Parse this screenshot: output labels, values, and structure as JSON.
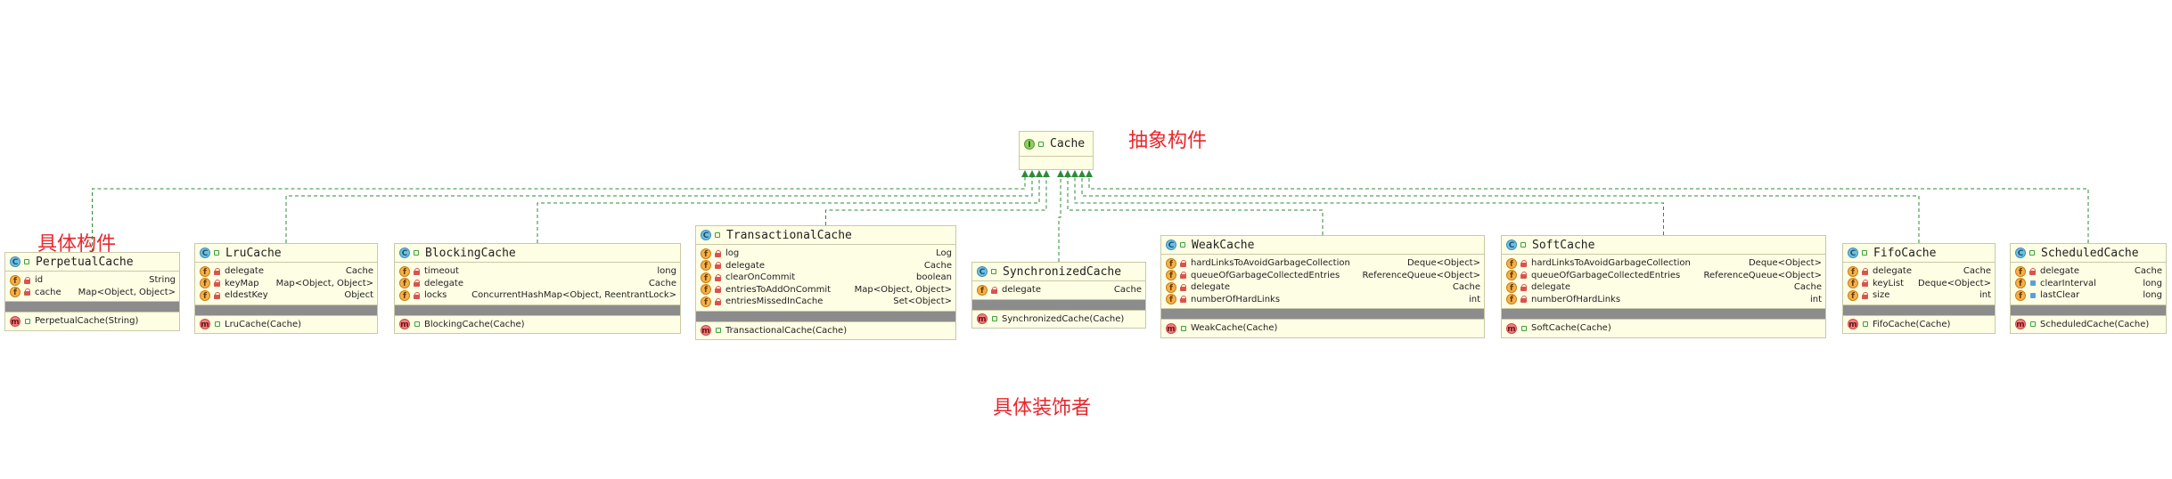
{
  "diagram": {
    "interface": {
      "name": "Cache",
      "icon": "interface-icon"
    },
    "labels": {
      "abstract_component": "抽象构件",
      "concrete_component": "具体构件",
      "concrete_decorator": "具体装饰者"
    },
    "classes": [
      {
        "key": "perpetual",
        "name": "PerpetualCache",
        "fields": [
          {
            "name": "id",
            "type": "String"
          },
          {
            "name": "cache",
            "type": "Map<Object, Object>"
          }
        ],
        "methods": [
          "PerpetualCache(String)"
        ]
      },
      {
        "key": "lru",
        "name": "LruCache",
        "fields": [
          {
            "name": "delegate",
            "type": "Cache"
          },
          {
            "name": "keyMap",
            "type": "Map<Object, Object>"
          },
          {
            "name": "eldestKey",
            "type": "Object"
          }
        ],
        "methods": [
          "LruCache(Cache)"
        ]
      },
      {
        "key": "blocking",
        "name": "BlockingCache",
        "fields": [
          {
            "name": "timeout",
            "type": "long"
          },
          {
            "name": "delegate",
            "type": "Cache"
          },
          {
            "name": "locks",
            "type": "ConcurrentHashMap<Object, ReentrantLock>"
          }
        ],
        "methods": [
          "BlockingCache(Cache)"
        ]
      },
      {
        "key": "transactional",
        "name": "TransactionalCache",
        "fields": [
          {
            "name": "log",
            "type": "Log"
          },
          {
            "name": "delegate",
            "type": "Cache"
          },
          {
            "name": "clearOnCommit",
            "type": "boolean"
          },
          {
            "name": "entriesToAddOnCommit",
            "type": "Map<Object, Object>"
          },
          {
            "name": "entriesMissedInCache",
            "type": "Set<Object>"
          }
        ],
        "methods": [
          "TransactionalCache(Cache)"
        ]
      },
      {
        "key": "synchronized",
        "name": "SynchronizedCache",
        "fields": [
          {
            "name": "delegate",
            "type": "Cache"
          }
        ],
        "methods": [
          "SynchronizedCache(Cache)"
        ]
      },
      {
        "key": "weak",
        "name": "WeakCache",
        "fields": [
          {
            "name": "hardLinksToAvoidGarbageCollection",
            "type": "Deque<Object>"
          },
          {
            "name": "queueOfGarbageCollectedEntries",
            "type": "ReferenceQueue<Object>"
          },
          {
            "name": "delegate",
            "type": "Cache"
          },
          {
            "name": "numberOfHardLinks",
            "type": "int"
          }
        ],
        "methods": [
          "WeakCache(Cache)"
        ]
      },
      {
        "key": "soft",
        "name": "SoftCache",
        "fields": [
          {
            "name": "hardLinksToAvoidGarbageCollection",
            "type": "Deque<Object>"
          },
          {
            "name": "queueOfGarbageCollectedEntries",
            "type": "ReferenceQueue<Object>"
          },
          {
            "name": "delegate",
            "type": "Cache"
          },
          {
            "name": "numberOfHardLinks",
            "type": "int"
          }
        ],
        "methods": [
          "SoftCache(Cache)"
        ]
      },
      {
        "key": "fifo",
        "name": "FifoCache",
        "fields": [
          {
            "name": "delegate",
            "type": "Cache"
          },
          {
            "name": "keyList",
            "type": "Deque<Object>"
          },
          {
            "name": "size",
            "type": "int"
          }
        ],
        "methods": [
          "FifoCache(Cache)"
        ]
      },
      {
        "key": "scheduled",
        "name": "ScheduledCache",
        "fields": [
          {
            "name": "delegate",
            "type": "Cache"
          },
          {
            "name": "clearInterval",
            "type": "long"
          },
          {
            "name": "lastClear",
            "type": "long"
          }
        ],
        "methods": [
          "ScheduledCache(Cache)"
        ]
      }
    ],
    "colors": {
      "class_fill": "#fefee5",
      "class_border": "#c9c9a8",
      "empty_section": "#8c8c8c",
      "link": "#2e8b3a",
      "label_red": "#e8262c"
    }
  }
}
